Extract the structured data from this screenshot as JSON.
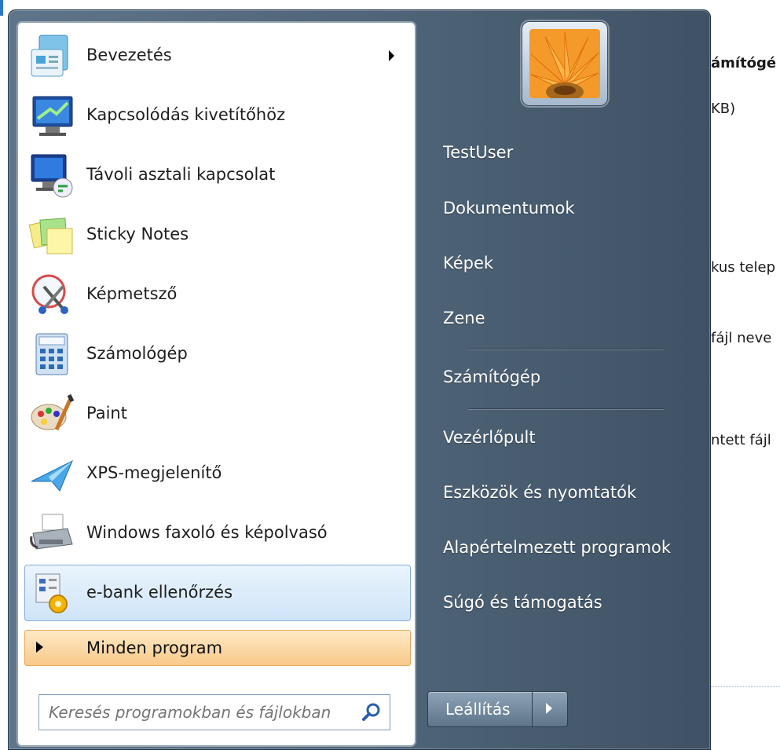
{
  "background_window": {
    "lines": [
      "ámítógé",
      "KB)",
      "kus telep",
      "fájl neve",
      "ntett fájl"
    ]
  },
  "programs": [
    {
      "label": "Bevezetés",
      "icon": "getting-started-icon",
      "has_submenu": true
    },
    {
      "label": "Kapcsolódás kivetítőhöz",
      "icon": "projector-icon"
    },
    {
      "label": "Távoli asztali kapcsolat",
      "icon": "remote-desktop-icon"
    },
    {
      "label": "Sticky Notes",
      "icon": "sticky-notes-icon"
    },
    {
      "label": "Képmetsző",
      "icon": "snipping-tool-icon"
    },
    {
      "label": "Számológép",
      "icon": "calculator-icon"
    },
    {
      "label": "Paint",
      "icon": "paint-palette-icon"
    },
    {
      "label": "XPS-megjelenítő",
      "icon": "xps-viewer-icon"
    },
    {
      "label": "Windows faxoló és képolvasó",
      "icon": "fax-scanner-icon"
    },
    {
      "label": "e-bank ellenőrzés",
      "icon": "task-scheduler-icon",
      "selected": true
    }
  ],
  "all_programs": {
    "label": "Minden program"
  },
  "search": {
    "placeholder": "Keresés programokban és fájlokban"
  },
  "user": {
    "avatar": "flower-avatar"
  },
  "right_menu": [
    {
      "label": "TestUser"
    },
    {
      "label": "Dokumentumok"
    },
    {
      "label": "Képek"
    },
    {
      "label": "Zene"
    },
    {
      "label": "Számítógép"
    },
    {
      "label": "Vezérlőpult"
    },
    {
      "label": "Eszközök és nyomtatók"
    },
    {
      "label": "Alapértelmezett programok"
    },
    {
      "label": "Súgó és támogatás"
    }
  ],
  "shutdown": {
    "label": "Leállítás"
  },
  "colors": {
    "selected_bg": "#cfe4f9",
    "all_programs_bg": "#f9c98a",
    "right_pane": "#4f6478"
  }
}
